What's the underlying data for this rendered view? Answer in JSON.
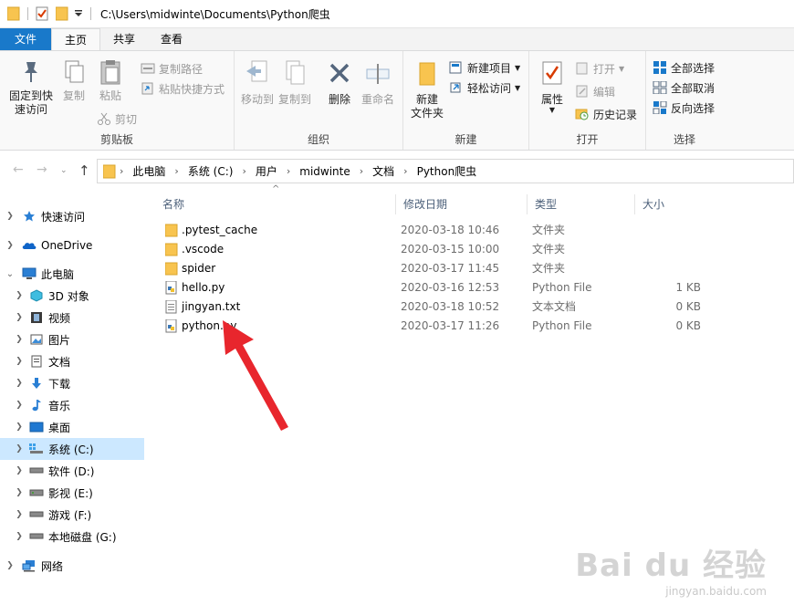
{
  "titlebar": {
    "path": "C:\\Users\\midwinte\\Documents\\Python爬虫"
  },
  "tabs": [
    {
      "label": "文件"
    },
    {
      "label": "主页"
    },
    {
      "label": "共享"
    },
    {
      "label": "查看"
    }
  ],
  "ribbon": {
    "clipboard": {
      "label": "剪贴板",
      "pin": "固定到快速访问",
      "pin_l1": "固定到快",
      "pin_l2": "速访问",
      "copy": "复制",
      "paste": "粘贴",
      "copy_path": "复制路径",
      "paste_shortcut": "粘贴快捷方式",
      "cut": "剪切"
    },
    "organize": {
      "label": "组织",
      "move_to": "移动到",
      "copy_to": "复制到",
      "delete": "删除",
      "rename": "重命名"
    },
    "new": {
      "label": "新建",
      "new_folder_l1": "新建",
      "new_folder_l2": "文件夹",
      "new_item": "新建项目",
      "easy_access": "轻松访问"
    },
    "open": {
      "label": "打开",
      "properties": "属性",
      "open": "打开",
      "edit": "编辑",
      "history": "历史记录"
    },
    "select": {
      "label": "选择",
      "select_all": "全部选择",
      "select_none": "全部取消",
      "invert": "反向选择"
    }
  },
  "breadcrumb": [
    "此电脑",
    "系统 (C:)",
    "用户",
    "midwinte",
    "文档",
    "Python爬虫"
  ],
  "nav": {
    "quick_access": "快速访问",
    "onedrive": "OneDrive",
    "this_pc": "此电脑",
    "objects3d": "3D 对象",
    "videos": "视频",
    "pictures": "图片",
    "documents": "文档",
    "downloads": "下载",
    "music": "音乐",
    "desktop": "桌面",
    "drive_c": "系统 (C:)",
    "drive_d": "软件 (D:)",
    "drive_e": "影视 (E:)",
    "drive_f": "游戏 (F:)",
    "drive_g": "本地磁盘 (G:)",
    "network": "网络"
  },
  "columns": {
    "name": "名称",
    "date": "修改日期",
    "type": "类型",
    "size": "大小"
  },
  "files": [
    {
      "name": ".pytest_cache",
      "date": "2020-03-18 10:46",
      "type": "文件夹",
      "size": ""
    },
    {
      "name": ".vscode",
      "date": "2020-03-15 10:00",
      "type": "文件夹",
      "size": ""
    },
    {
      "name": "spider",
      "date": "2020-03-17 11:45",
      "type": "文件夹",
      "size": ""
    },
    {
      "name": "hello.py",
      "date": "2020-03-16 12:53",
      "type": "Python File",
      "size": "1 KB"
    },
    {
      "name": "jingyan.txt",
      "date": "2020-03-18 10:52",
      "type": "文本文档",
      "size": "0 KB"
    },
    {
      "name": "python.py",
      "date": "2020-03-17 11:26",
      "type": "Python File",
      "size": "0 KB"
    }
  ],
  "watermark": {
    "brand": "Bai du 经验",
    "url": "jingyan.baidu.com"
  },
  "colors": {
    "accent": "#1979ca",
    "selected": "#cce8ff",
    "arrow": "#e8262d",
    "folder": "#f8c44f"
  }
}
